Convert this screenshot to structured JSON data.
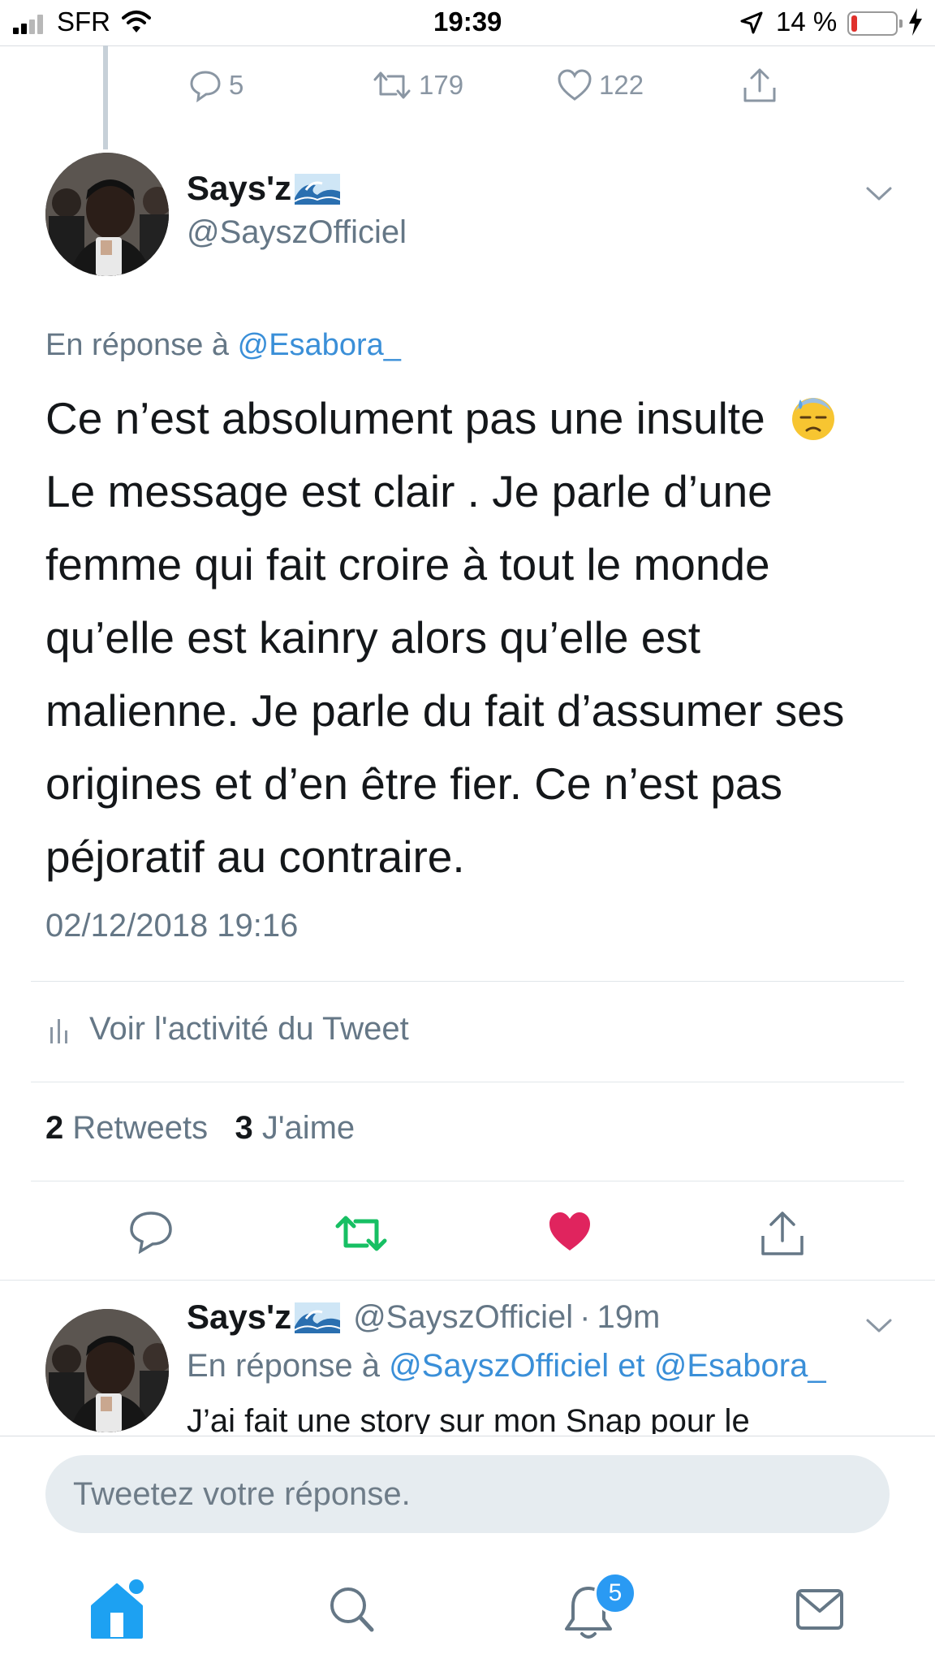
{
  "status_bar": {
    "carrier": "SFR",
    "time": "19:39",
    "battery": "14 %",
    "battery_level": 0.14
  },
  "previous_tweet": {
    "replies": "5",
    "retweets": "179",
    "likes": "122"
  },
  "tweet": {
    "name": "Says'z",
    "handle": "@SayszOfficiel",
    "reply_prefix": "En réponse à",
    "reply_to": "@Esabora_",
    "text_lines": [
      "Ce n’est absolument pas une insulte",
      "Le message est clair . Je parle d’une",
      "femme qui fait croire à tout le monde",
      "qu’elle est kainry alors qu’elle est",
      "malienne. Je parle du fait d’assumer ses",
      "origines et d’en être fier. Ce n’est pas",
      "péjoratif au contraire."
    ],
    "emoji": "downcast-face-with-sweat",
    "timestamp": "02/12/2018 19:16",
    "activity_label": "Voir l'activité du Tweet",
    "retweet_count": "2",
    "retweet_label": "Retweets",
    "like_count": "3",
    "like_label": "J'aime",
    "liked": true
  },
  "reply_tweet": {
    "name": "Says'z",
    "handle": "@SayszOfficiel",
    "sep": "·",
    "time_ago": "19m",
    "reply_prefix": "En réponse à",
    "reply_to_1": "@SayszOfficiel",
    "reply_and": "et",
    "reply_to_2": "@Esabora_",
    "text_preview": "J’ai fait une story sur mon Snap pour le"
  },
  "composer": {
    "placeholder": "Tweetez votre réponse."
  },
  "tabbar": {
    "notification_badge": "5"
  },
  "colors": {
    "accent": "#1da1f2",
    "link": "#3a8fd8",
    "retweet_green": "#17bf63",
    "like_red": "#e0245e",
    "muted": "#657786"
  }
}
